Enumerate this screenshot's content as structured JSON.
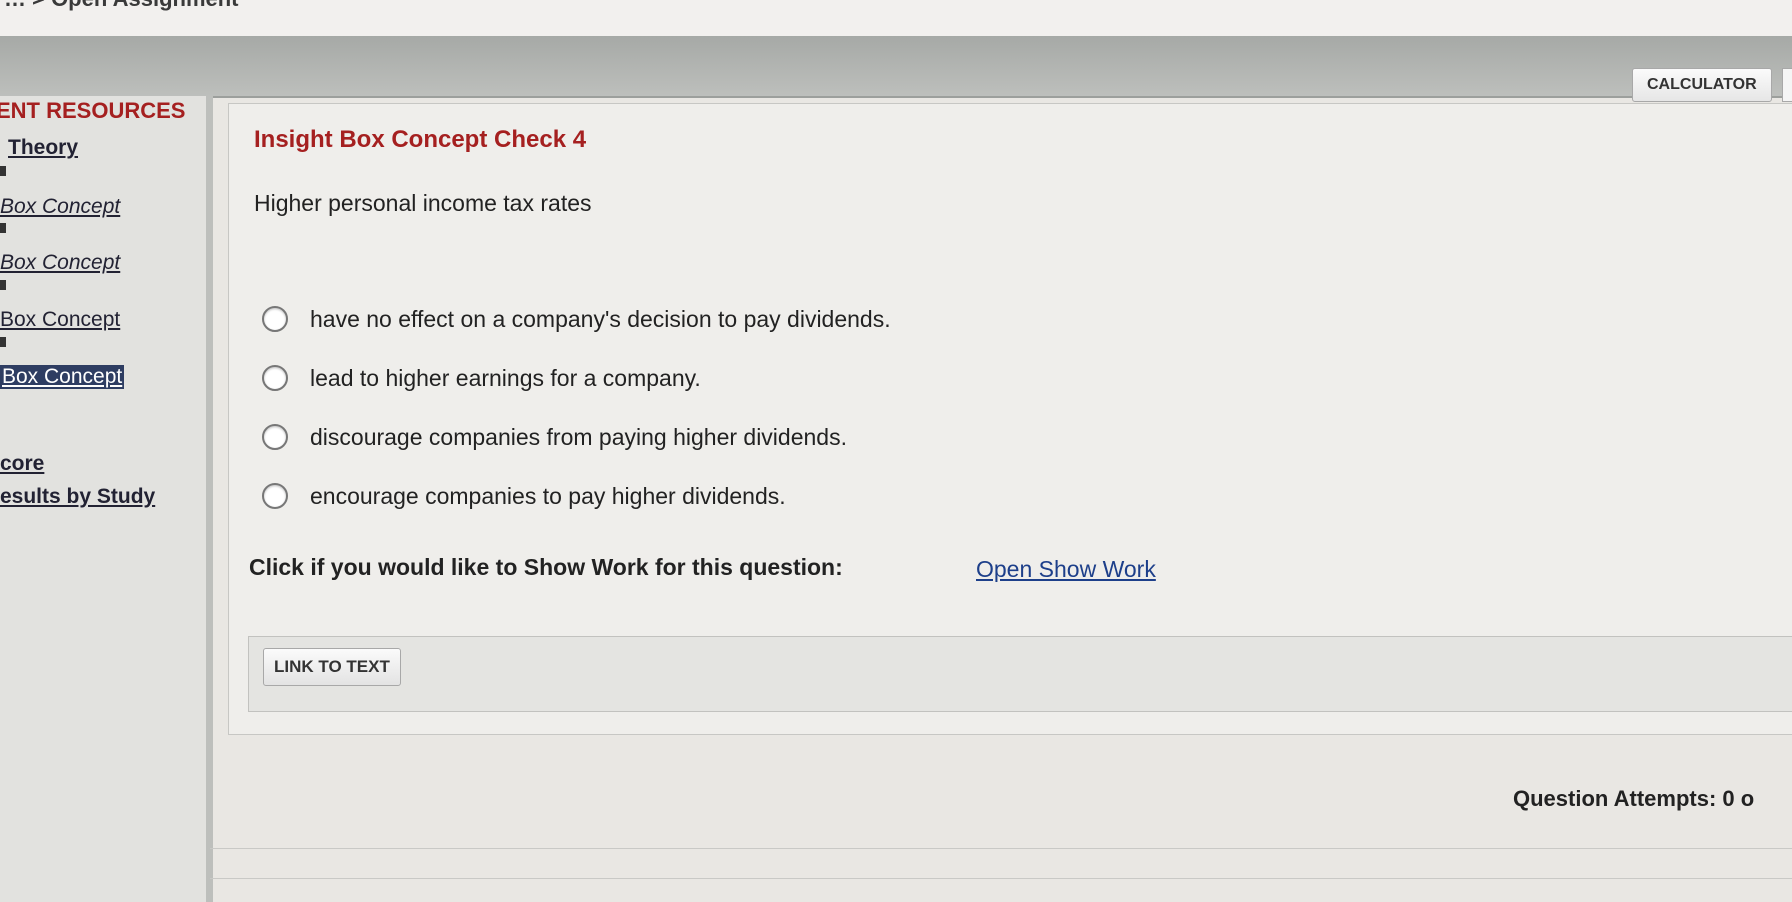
{
  "breadcrumb": {
    "text": "…  >  Open Assignment"
  },
  "toolbar": {
    "calculator_label": "CALCULATOR"
  },
  "sidebar": {
    "title": "ENT RESOURCES",
    "items": [
      {
        "label": "Theory"
      },
      {
        "label": "Box Concept"
      },
      {
        "label": "Box Concept"
      },
      {
        "label": "Box Concept"
      },
      {
        "label": "Box Concept"
      },
      {
        "label": "core"
      },
      {
        "label": "esults by Study"
      }
    ]
  },
  "question": {
    "title": "Insight Box Concept Check 4",
    "stem": "Higher personal income tax rates",
    "options": [
      {
        "label": "have no effect on a company's decision to pay dividends."
      },
      {
        "label": "lead to higher earnings for a company."
      },
      {
        "label": "discourage companies from paying higher dividends."
      },
      {
        "label": "encourage companies to pay higher dividends."
      }
    ]
  },
  "show_work": {
    "prompt": "Click if you would like to Show Work for this question:",
    "link_label": "Open Show Work"
  },
  "link_to_text": {
    "label": "LINK TO TEXT"
  },
  "attempts": {
    "label": "Question Attempts: 0 o"
  },
  "colors": {
    "accent_red": "#a52020",
    "link_blue": "#1d3f8a",
    "selected_bg": "#2e3d62"
  }
}
